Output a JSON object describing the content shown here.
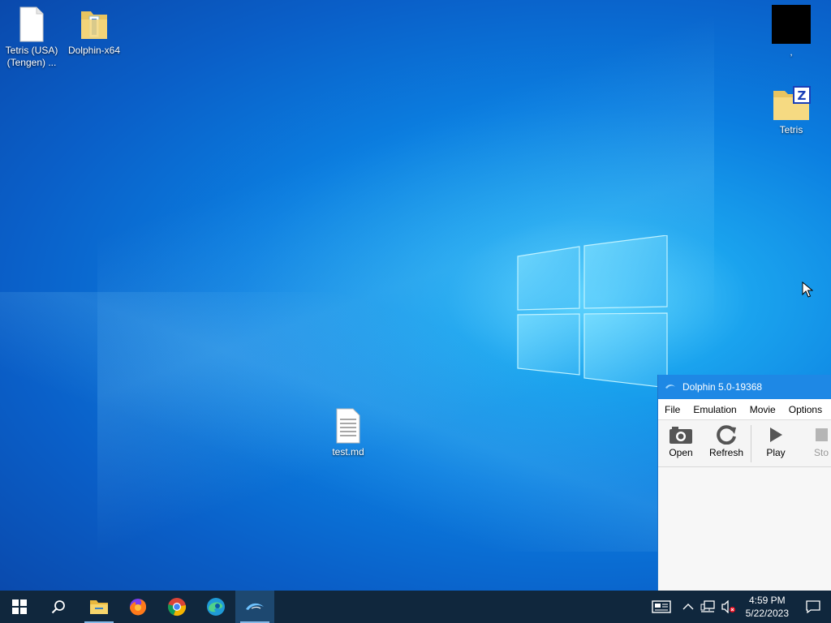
{
  "desktop": {
    "icons": [
      {
        "label": "Tetris (USA)\n(Tengen) ..."
      },
      {
        "label": "Dolphin-x64"
      },
      {
        "label": ","
      },
      {
        "label": "Tetris"
      },
      {
        "label": "test.md"
      }
    ]
  },
  "dolphin": {
    "title": "Dolphin 5.0-19368",
    "menu": [
      "File",
      "Emulation",
      "Movie",
      "Options"
    ],
    "toolbar": {
      "open": "Open",
      "refresh": "Refresh",
      "play": "Play",
      "stop": "Sto"
    }
  },
  "taskbar": {
    "clock_time": "4:59 PM",
    "clock_date": "5/22/2023"
  },
  "colors": {
    "taskbar": "#10273d",
    "title_bar": "#1e88e5"
  }
}
